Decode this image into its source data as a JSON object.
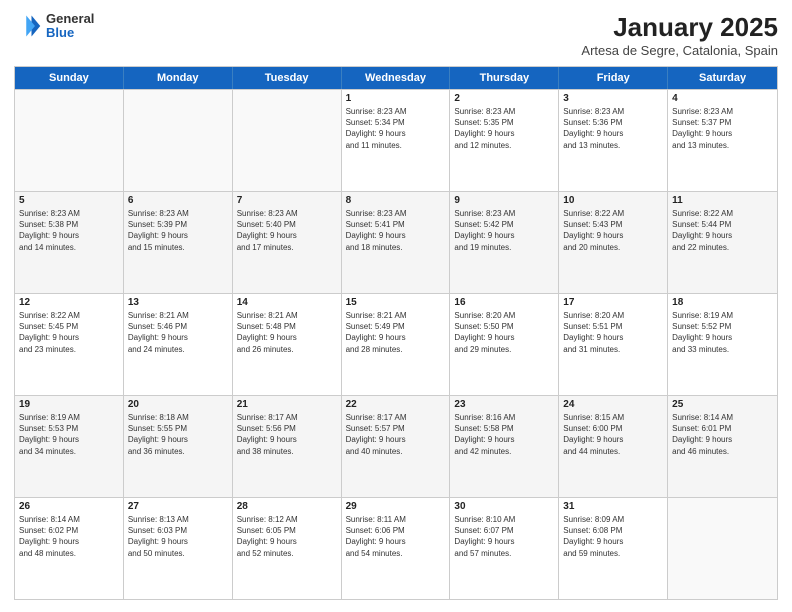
{
  "logo": {
    "general": "General",
    "blue": "Blue"
  },
  "title": "January 2025",
  "subtitle": "Artesa de Segre, Catalonia, Spain",
  "weekdays": [
    "Sunday",
    "Monday",
    "Tuesday",
    "Wednesday",
    "Thursday",
    "Friday",
    "Saturday"
  ],
  "rows": [
    [
      {
        "date": "",
        "info": ""
      },
      {
        "date": "",
        "info": ""
      },
      {
        "date": "",
        "info": ""
      },
      {
        "date": "1",
        "info": "Sunrise: 8:23 AM\nSunset: 5:34 PM\nDaylight: 9 hours\nand 11 minutes."
      },
      {
        "date": "2",
        "info": "Sunrise: 8:23 AM\nSunset: 5:35 PM\nDaylight: 9 hours\nand 12 minutes."
      },
      {
        "date": "3",
        "info": "Sunrise: 8:23 AM\nSunset: 5:36 PM\nDaylight: 9 hours\nand 13 minutes."
      },
      {
        "date": "4",
        "info": "Sunrise: 8:23 AM\nSunset: 5:37 PM\nDaylight: 9 hours\nand 13 minutes."
      }
    ],
    [
      {
        "date": "5",
        "info": "Sunrise: 8:23 AM\nSunset: 5:38 PM\nDaylight: 9 hours\nand 14 minutes."
      },
      {
        "date": "6",
        "info": "Sunrise: 8:23 AM\nSunset: 5:39 PM\nDaylight: 9 hours\nand 15 minutes."
      },
      {
        "date": "7",
        "info": "Sunrise: 8:23 AM\nSunset: 5:40 PM\nDaylight: 9 hours\nand 17 minutes."
      },
      {
        "date": "8",
        "info": "Sunrise: 8:23 AM\nSunset: 5:41 PM\nDaylight: 9 hours\nand 18 minutes."
      },
      {
        "date": "9",
        "info": "Sunrise: 8:23 AM\nSunset: 5:42 PM\nDaylight: 9 hours\nand 19 minutes."
      },
      {
        "date": "10",
        "info": "Sunrise: 8:22 AM\nSunset: 5:43 PM\nDaylight: 9 hours\nand 20 minutes."
      },
      {
        "date": "11",
        "info": "Sunrise: 8:22 AM\nSunset: 5:44 PM\nDaylight: 9 hours\nand 22 minutes."
      }
    ],
    [
      {
        "date": "12",
        "info": "Sunrise: 8:22 AM\nSunset: 5:45 PM\nDaylight: 9 hours\nand 23 minutes."
      },
      {
        "date": "13",
        "info": "Sunrise: 8:21 AM\nSunset: 5:46 PM\nDaylight: 9 hours\nand 24 minutes."
      },
      {
        "date": "14",
        "info": "Sunrise: 8:21 AM\nSunset: 5:48 PM\nDaylight: 9 hours\nand 26 minutes."
      },
      {
        "date": "15",
        "info": "Sunrise: 8:21 AM\nSunset: 5:49 PM\nDaylight: 9 hours\nand 28 minutes."
      },
      {
        "date": "16",
        "info": "Sunrise: 8:20 AM\nSunset: 5:50 PM\nDaylight: 9 hours\nand 29 minutes."
      },
      {
        "date": "17",
        "info": "Sunrise: 8:20 AM\nSunset: 5:51 PM\nDaylight: 9 hours\nand 31 minutes."
      },
      {
        "date": "18",
        "info": "Sunrise: 8:19 AM\nSunset: 5:52 PM\nDaylight: 9 hours\nand 33 minutes."
      }
    ],
    [
      {
        "date": "19",
        "info": "Sunrise: 8:19 AM\nSunset: 5:53 PM\nDaylight: 9 hours\nand 34 minutes."
      },
      {
        "date": "20",
        "info": "Sunrise: 8:18 AM\nSunset: 5:55 PM\nDaylight: 9 hours\nand 36 minutes."
      },
      {
        "date": "21",
        "info": "Sunrise: 8:17 AM\nSunset: 5:56 PM\nDaylight: 9 hours\nand 38 minutes."
      },
      {
        "date": "22",
        "info": "Sunrise: 8:17 AM\nSunset: 5:57 PM\nDaylight: 9 hours\nand 40 minutes."
      },
      {
        "date": "23",
        "info": "Sunrise: 8:16 AM\nSunset: 5:58 PM\nDaylight: 9 hours\nand 42 minutes."
      },
      {
        "date": "24",
        "info": "Sunrise: 8:15 AM\nSunset: 6:00 PM\nDaylight: 9 hours\nand 44 minutes."
      },
      {
        "date": "25",
        "info": "Sunrise: 8:14 AM\nSunset: 6:01 PM\nDaylight: 9 hours\nand 46 minutes."
      }
    ],
    [
      {
        "date": "26",
        "info": "Sunrise: 8:14 AM\nSunset: 6:02 PM\nDaylight: 9 hours\nand 48 minutes."
      },
      {
        "date": "27",
        "info": "Sunrise: 8:13 AM\nSunset: 6:03 PM\nDaylight: 9 hours\nand 50 minutes."
      },
      {
        "date": "28",
        "info": "Sunrise: 8:12 AM\nSunset: 6:05 PM\nDaylight: 9 hours\nand 52 minutes."
      },
      {
        "date": "29",
        "info": "Sunrise: 8:11 AM\nSunset: 6:06 PM\nDaylight: 9 hours\nand 54 minutes."
      },
      {
        "date": "30",
        "info": "Sunrise: 8:10 AM\nSunset: 6:07 PM\nDaylight: 9 hours\nand 57 minutes."
      },
      {
        "date": "31",
        "info": "Sunrise: 8:09 AM\nSunset: 6:08 PM\nDaylight: 9 hours\nand 59 minutes."
      },
      {
        "date": "",
        "info": ""
      }
    ]
  ]
}
